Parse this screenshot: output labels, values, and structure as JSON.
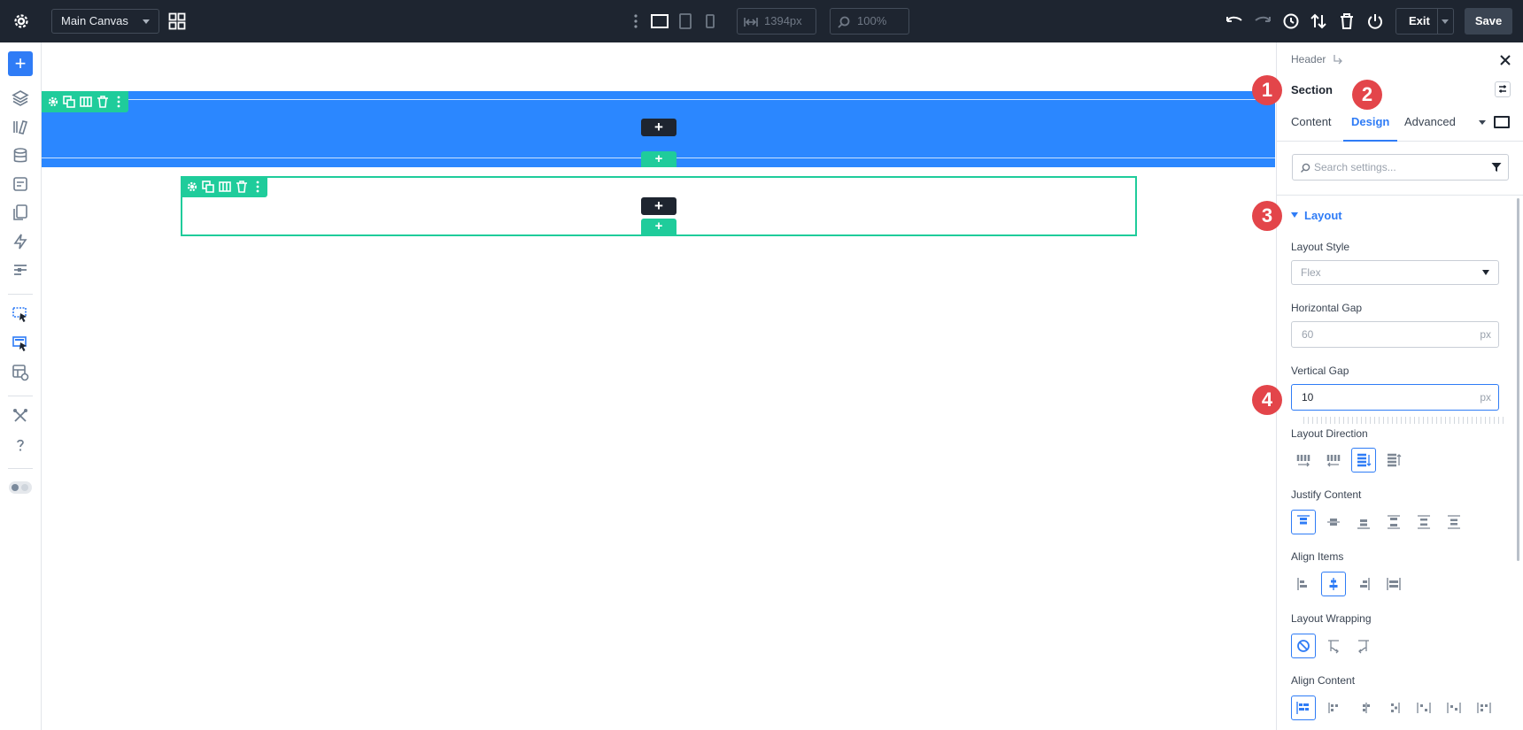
{
  "topbar": {
    "canvas_select": "Main Canvas",
    "width_value": "1394px",
    "zoom_value": "100%",
    "exit_label": "Exit",
    "save_label": "Save"
  },
  "canvas": {
    "plus": "+"
  },
  "panel": {
    "breadcrumb": "Header",
    "title": "Section",
    "tabs": [
      "Content",
      "Design",
      "Advanced"
    ],
    "active_tab": "Design",
    "search_placeholder": "Search settings...",
    "group": "Layout",
    "fields": {
      "layout_style": {
        "label": "Layout Style",
        "value": "Flex"
      },
      "horizontal_gap": {
        "label": "Horizontal Gap",
        "value": "60",
        "unit": "px"
      },
      "vertical_gap": {
        "label": "Vertical Gap",
        "value": "10",
        "unit": "px"
      },
      "layout_direction": {
        "label": "Layout Direction",
        "selected_index": 2
      },
      "justify_content": {
        "label": "Justify Content",
        "selected_index": 0
      },
      "align_items": {
        "label": "Align Items",
        "selected_index": 1
      },
      "layout_wrapping": {
        "label": "Layout Wrapping",
        "selected_index": 0
      },
      "align_content": {
        "label": "Align Content",
        "selected_index": 0
      }
    }
  },
  "badges": [
    "1",
    "2",
    "3",
    "4"
  ],
  "colors": {
    "accent": "#2f7cf6",
    "section": "#2b87ff",
    "green": "#1fcc9b",
    "topbar": "#1e2530",
    "badge": "#e3454a"
  }
}
